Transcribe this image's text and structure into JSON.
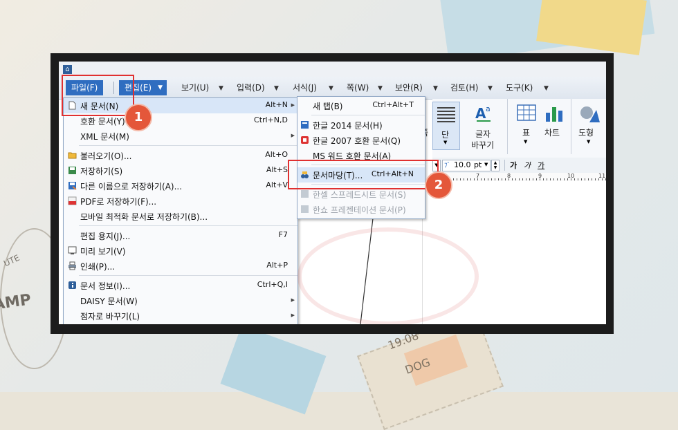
{
  "menubar": {
    "file": "파일(F)",
    "edit": "편집(E)",
    "view": "보기(U)",
    "input": "입력(D)",
    "format": "서식(J)",
    "page": "쪽(W)",
    "security": "보안(R)",
    "review": "검토(H)",
    "tools": "도구(K)"
  },
  "toolbar": {
    "page_partial": "쪽",
    "column": "단",
    "char_change_1": "글자",
    "char_change_2": "바꾸기",
    "table": "표",
    "chart": "차트",
    "shape": "도형"
  },
  "format_bar": {
    "font_size": "10.0",
    "unit": "pt",
    "bold": "가",
    "italic": "가",
    "underline": "가"
  },
  "ruler": {
    "marks": [
      "7",
      "8",
      "9",
      "10",
      "11"
    ]
  },
  "file_menu": {
    "new_doc": {
      "label": "새 문서(N)",
      "shortcut": "Alt+N"
    },
    "compat_doc": {
      "label": "호환 문서(Y)",
      "shortcut": "Ctrl+N,D"
    },
    "xml_doc": {
      "label": "XML 문서(M)"
    },
    "open": {
      "label": "불러오기(O)...",
      "shortcut": "Alt+O"
    },
    "save": {
      "label": "저장하기(S)",
      "shortcut": "Alt+S"
    },
    "save_as": {
      "label": "다른 이름으로 저장하기(A)...",
      "shortcut": "Alt+V"
    },
    "save_pdf": {
      "label": "PDF로 저장하기(F)..."
    },
    "save_mobile": {
      "label": "모바일 최적화 문서로 저장하기(B)..."
    },
    "page_setup": {
      "label": "편집 용지(J)...",
      "shortcut": "F7"
    },
    "preview": {
      "label": "미리 보기(V)"
    },
    "print": {
      "label": "인쇄(P)...",
      "shortcut": "Alt+P"
    },
    "doc_info": {
      "label": "문서 정보(I)...",
      "shortcut": "Ctrl+Q,I"
    },
    "daisy": {
      "label": "DAISY 문서(W)"
    },
    "braille": {
      "label": "점자로 바꾸기(L)"
    }
  },
  "new_submenu": {
    "new_tab": {
      "label": "새 탭(B)",
      "shortcut": "Ctrl+Alt+T"
    },
    "hangul2014": {
      "label": "한글 2014 문서(H)"
    },
    "hangul2007": {
      "label": "한글 2007 호환 문서(Q)"
    },
    "msword": {
      "label": "MS 워드 호환 문서(A)"
    },
    "wizard": {
      "label": "문서마당(T)...",
      "shortcut": "Ctrl+Alt+N"
    },
    "hancell": {
      "label": "한셀 스프레드시트 문서(S)"
    },
    "hanshow": {
      "label": "한쇼 프레젠테이션 문서(P)"
    }
  },
  "badges": {
    "step1": "1",
    "step2": "2"
  },
  "stamps": {
    "amp": "AMP",
    "date": "19.08",
    "dog": "DOG",
    "ute": "UTE"
  },
  "colors": {
    "accent": "#2f6dc0",
    "highlight_box": "#e03030",
    "badge": "#e4573a"
  }
}
